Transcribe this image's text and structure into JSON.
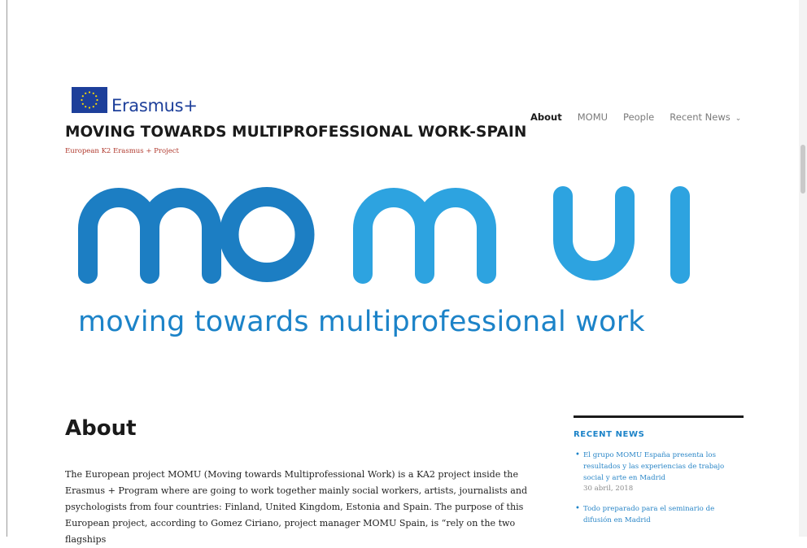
{
  "header": {
    "brand": {
      "flag_icon": "eu-flag-icon",
      "flag_color": "#1d3f9a",
      "name": "Erasmus+"
    },
    "site_title": "MOVING TOWARDS MULTIPROFESSIONAL WORK-SPAIN",
    "site_description": "European K2 Erasmus + Project"
  },
  "nav": {
    "items": [
      {
        "label": "About",
        "active": true
      },
      {
        "label": "MOMU",
        "active": false
      },
      {
        "label": "People",
        "active": false
      },
      {
        "label": "Recent News",
        "active": false,
        "has_submenu": true
      }
    ],
    "submenu_icon": "chevron-down-icon"
  },
  "banner": {
    "logo_text": "momu",
    "tagline": "moving towards multiprofessional work",
    "colors": {
      "dark": "#1c7ec3",
      "light": "#2da3e0"
    }
  },
  "main": {
    "title": "About",
    "body": "The European project MOMU (Moving towards Multiprofessional Work) is a KA2 project inside the Erasmus + Program where are going to work together mainly social workers, artists, journalists and psychologists from four countries: Finland, United Kingdom, Estonia and Spain. The purpose of this European project, according to Gomez Ciriano, project manager MOMU Spain, is “rely on the two flagships"
  },
  "sidebar": {
    "widget_title": "RECENT NEWS",
    "news": [
      {
        "title": "El grupo MOMU España presenta los resultados y las experiencias de trabajo social y arte en Madrid",
        "date": "30 abril, 2018"
      },
      {
        "title": "Todo preparado para el seminario de difusión en Madrid",
        "date": ""
      }
    ]
  },
  "colors": {
    "accent": "#1c83c8",
    "title_text": "#1a1a1a",
    "description_text": "#b0392d"
  }
}
